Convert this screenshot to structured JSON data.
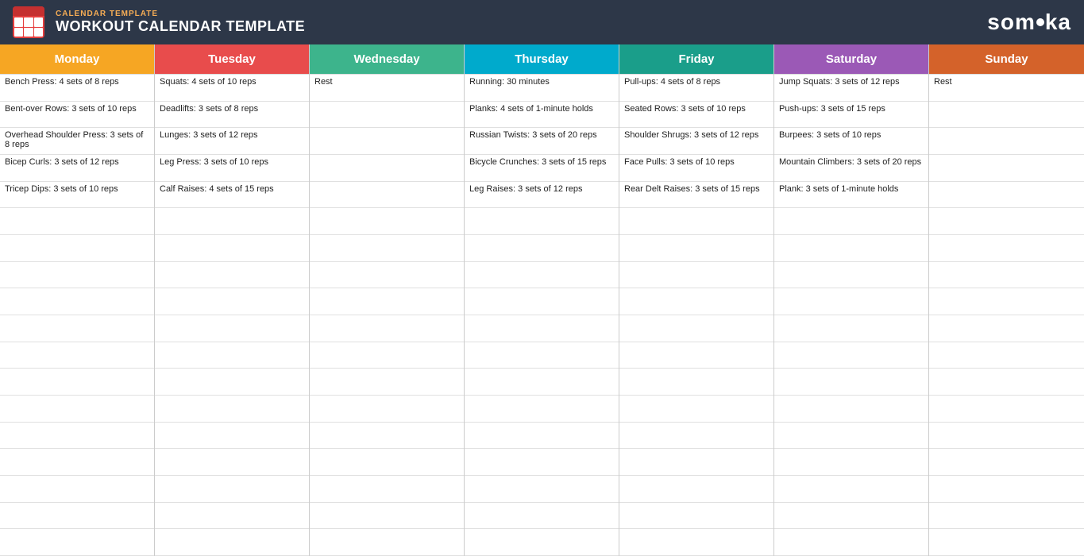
{
  "header": {
    "subtitle": "CALENDAR TEMPLATE",
    "title": "WORKOUT CALENDAR TEMPLATE",
    "logo": "someka"
  },
  "days": [
    {
      "id": "monday",
      "label": "Monday",
      "color": "#f6a623",
      "items": [
        "Bench Press: 4 sets of 8 reps",
        "Bent-over Rows: 3 sets of 10 reps",
        "Overhead Shoulder Press: 3 sets of 8 reps",
        "Bicep Curls: 3 sets of 12 reps",
        "Tricep Dips: 3 sets of 10 reps",
        "",
        "",
        "",
        "",
        "",
        "",
        "",
        "",
        "",
        "",
        "",
        "",
        "",
        ""
      ]
    },
    {
      "id": "tuesday",
      "label": "Tuesday",
      "color": "#e84c4c",
      "items": [
        "Squats: 4 sets of 10 reps",
        "Deadlifts: 3 sets of 8 reps",
        "Lunges: 3 sets of 12 reps",
        "Leg Press: 3 sets of 10 reps",
        "Calf Raises: 4 sets of 15 reps",
        "",
        "",
        "",
        "",
        "",
        "",
        "",
        "",
        "",
        "",
        "",
        "",
        "",
        ""
      ]
    },
    {
      "id": "wednesday",
      "label": "Wednesday",
      "color": "#3db48c",
      "items": [
        "Rest",
        "",
        "",
        "",
        "",
        "",
        "",
        "",
        "",
        "",
        "",
        "",
        "",
        "",
        "",
        "",
        "",
        "",
        ""
      ]
    },
    {
      "id": "thursday",
      "label": "Thursday",
      "color": "#00aacc",
      "items": [
        "Running: 30 minutes",
        "Planks: 4 sets of 1-minute holds",
        "Russian Twists: 3 sets of 20 reps",
        "Bicycle Crunches: 3 sets of 15 reps",
        "Leg Raises: 3 sets of 12 reps",
        "",
        "",
        "",
        "",
        "",
        "",
        "",
        "",
        "",
        "",
        "",
        "",
        "",
        ""
      ]
    },
    {
      "id": "friday",
      "label": "Friday",
      "color": "#1a9e8a",
      "items": [
        "Pull-ups: 4 sets of 8 reps",
        "Seated Rows: 3 sets of 10 reps",
        "Shoulder Shrugs: 3 sets of 12 reps",
        "Face Pulls: 3 sets of 10 reps",
        "Rear Delt Raises: 3 sets of 15 reps",
        "",
        "",
        "",
        "",
        "",
        "",
        "",
        "",
        "",
        "",
        "",
        "",
        "",
        ""
      ]
    },
    {
      "id": "saturday",
      "label": "Saturday",
      "color": "#9b59b6",
      "items": [
        "Jump Squats: 3 sets of 12 reps",
        "Push-ups: 3 sets of 15 reps",
        "Burpees: 3 sets of 10 reps",
        "Mountain Climbers: 3 sets of 20 reps",
        "Plank: 3 sets of 1-minute holds",
        "",
        "",
        "",
        "",
        "",
        "",
        "",
        "",
        "",
        "",
        "",
        "",
        "",
        ""
      ]
    },
    {
      "id": "sunday",
      "label": "Sunday",
      "color": "#d4622a",
      "items": [
        "Rest",
        "",
        "",
        "",
        "",
        "",
        "",
        "",
        "",
        "",
        "",
        "",
        "",
        "",
        "",
        "",
        "",
        "",
        ""
      ]
    }
  ]
}
